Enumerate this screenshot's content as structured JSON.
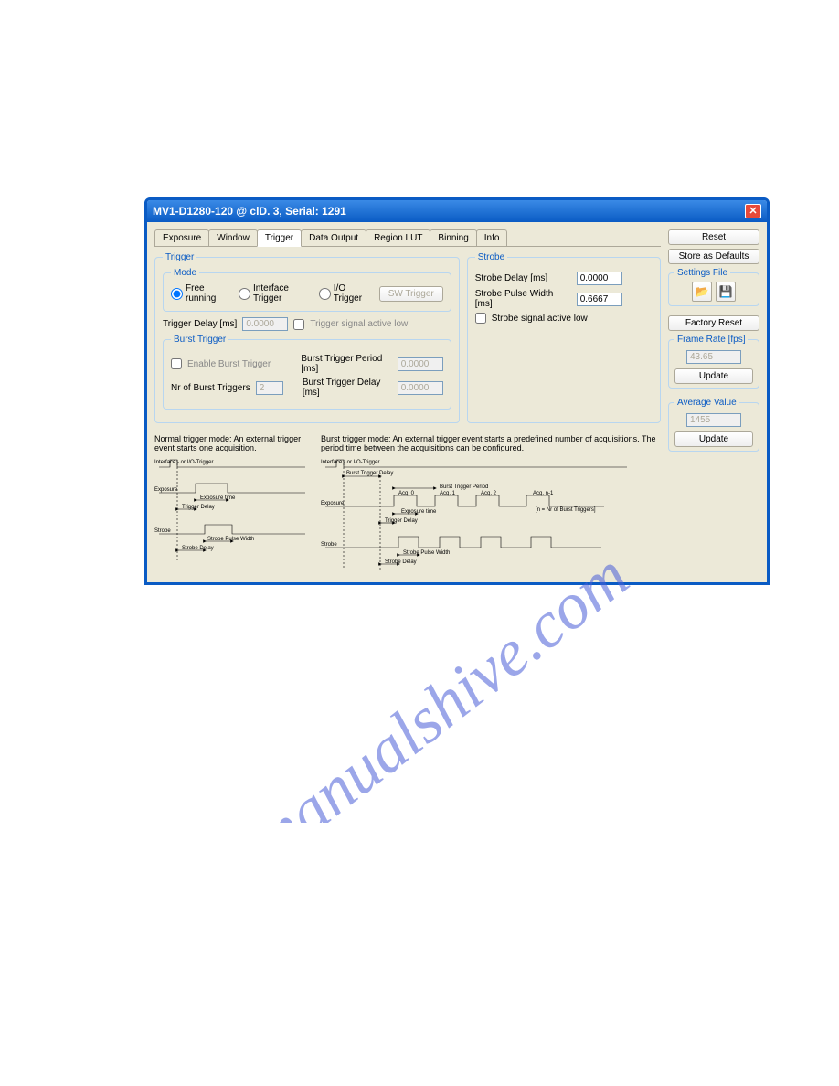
{
  "titlebar": {
    "title": "MV1-D1280-120 @ clD. 3, Serial: 1291"
  },
  "tabs": [
    "Exposure",
    "Window",
    "Trigger",
    "Data Output",
    "Region LUT",
    "Binning",
    "Info"
  ],
  "activeTab": "Trigger",
  "trigger": {
    "legend": "Trigger",
    "mode": {
      "legend": "Mode",
      "free": "Free running",
      "iface": "Interface Trigger",
      "io": "I/O Trigger",
      "sw": "SW Trigger"
    },
    "delayLabel": "Trigger Delay [ms]",
    "delayValue": "0.0000",
    "activeLow": "Trigger signal active low",
    "burst": {
      "legend": "Burst Trigger",
      "enable": "Enable Burst Trigger",
      "nrLabel": "Nr of Burst Triggers",
      "nrValue": "2",
      "periodLabel": "Burst Trigger Period [ms]",
      "periodValue": "0.0000",
      "bdelayLabel": "Burst Trigger Delay [ms]",
      "bdelayValue": "0.0000"
    }
  },
  "strobe": {
    "legend": "Strobe",
    "delayLabel": "Strobe Delay [ms]",
    "delayValue": "0.0000",
    "pulseLabel": "Strobe Pulse Width [ms]",
    "pulseValue": "0.6667",
    "activeLow": "Strobe signal active low"
  },
  "side": {
    "reset": "Reset",
    "storeDefaults": "Store as Defaults",
    "settingsFile": "Settings File",
    "factoryReset": "Factory Reset",
    "frameRate": {
      "legend": "Frame Rate [fps]",
      "value": "43.65",
      "update": "Update"
    },
    "avgValue": {
      "legend": "Average Value",
      "value": "1455",
      "update": "Update"
    }
  },
  "desc": {
    "normal": "Normal trigger mode: An external trigger event starts one acquisition.",
    "burst": "Burst trigger mode: An external trigger event starts a predefined number of acquisitions. The period time between the acquisitions can be configured."
  },
  "diagLabels": {
    "ifTrigger": "Interface - or I/O-Trigger",
    "exposure": "Exposure",
    "strobe": "Strobe",
    "expTime": "Exposure time",
    "trigDelay": "Trigger Delay",
    "strobePW": "Strobe Pulse Width",
    "strobeDelay": "Strobe Delay",
    "burstTrigDelay": "Burst Trigger Delay",
    "burstTrigPeriod": "Burst Trigger Period",
    "acq0": "Acq. 0",
    "acq1": "Acq. 1",
    "acq2": "Acq. 2",
    "acqn": "Acq. n-1",
    "nNote": "[n = Nr of Burst Triggers]"
  },
  "watermark": "manualshive.com"
}
